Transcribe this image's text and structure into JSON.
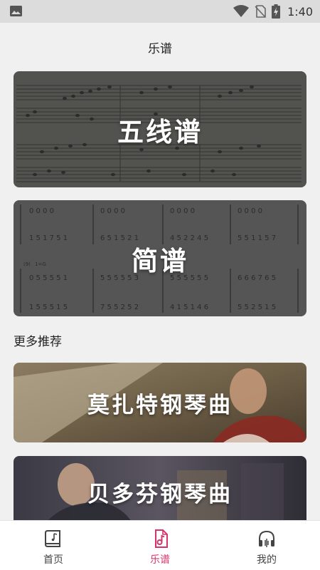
{
  "status_bar": {
    "time": "1:40",
    "icons": [
      "gallery-icon",
      "wifi-icon",
      "no-sim-icon",
      "battery-charging-icon"
    ]
  },
  "page_title": "乐谱",
  "score_cards": [
    {
      "label": "五线谱"
    },
    {
      "label": "简谱"
    }
  ],
  "more_section": {
    "title": "更多推荐",
    "items": [
      {
        "label": "莫扎特钢琴曲"
      },
      {
        "label": "贝多芬钢琴曲"
      }
    ]
  },
  "jianpu_text": {
    "key": "1=G",
    "measure_number": "(9)"
  },
  "bottom_nav": {
    "items": [
      {
        "label": "首页",
        "icon": "home-book-icon",
        "active": false
      },
      {
        "label": "乐谱",
        "icon": "music-note-icon",
        "active": true
      },
      {
        "label": "我的",
        "icon": "headphones-icon",
        "active": false
      }
    ]
  },
  "colors": {
    "accent": "#d6336c",
    "card_overlay": "#5a5a5a",
    "background": "#f0f0f0"
  }
}
